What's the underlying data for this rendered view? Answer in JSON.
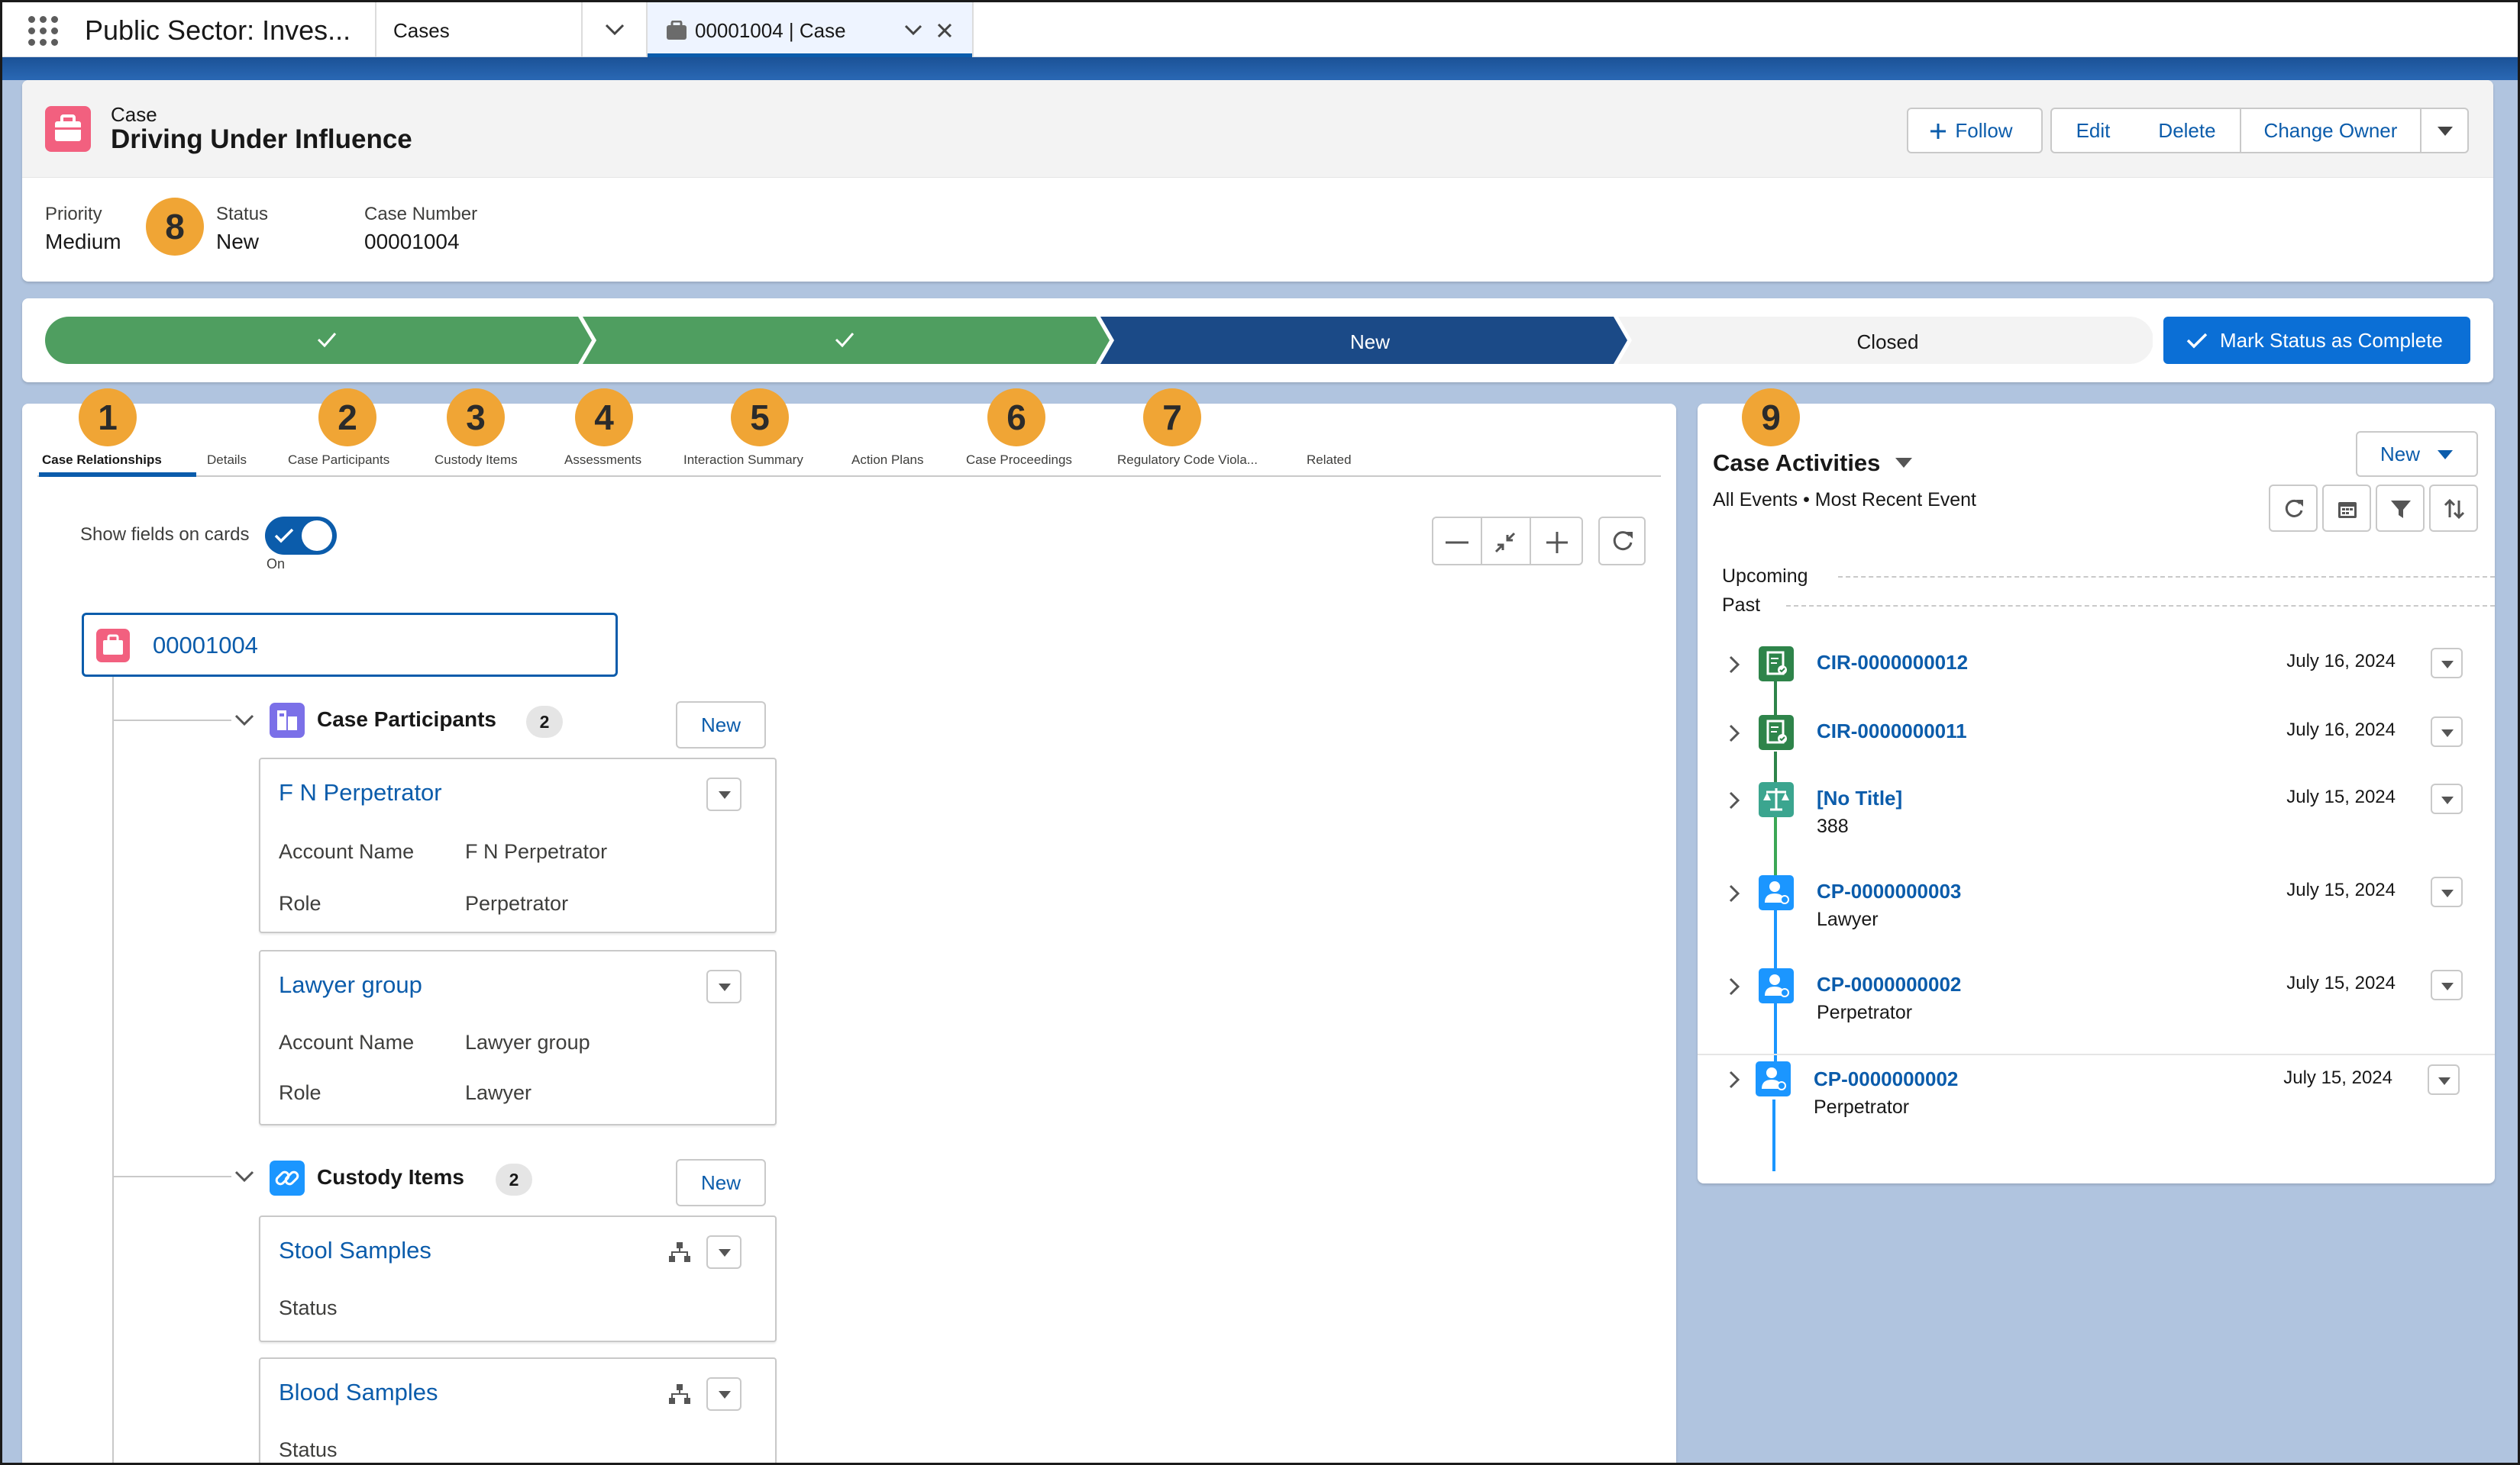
{
  "app": {
    "name": "Public Sector: Inves...",
    "tabs": [
      {
        "label": "Cases"
      },
      {
        "label": "00001004 | Case"
      }
    ]
  },
  "record": {
    "object_label": "Case",
    "title": "Driving Under Influence",
    "actions": {
      "follow": "Follow",
      "edit": "Edit",
      "delete": "Delete",
      "change_owner": "Change Owner"
    },
    "fields": [
      {
        "label": "Priority",
        "value": "Medium"
      },
      {
        "label": "Status",
        "value": "New"
      },
      {
        "label": "Case Number",
        "value": "00001004"
      }
    ]
  },
  "path": {
    "stages": [
      {
        "label": "",
        "state": "complete"
      },
      {
        "label": "",
        "state": "complete"
      },
      {
        "label": "New",
        "state": "current"
      },
      {
        "label": "Closed",
        "state": "incomplete"
      }
    ],
    "mark_button": "Mark Status as Complete"
  },
  "callouts": [
    "1",
    "2",
    "3",
    "4",
    "5",
    "6",
    "7",
    "8",
    "9"
  ],
  "main": {
    "tabs": [
      {
        "label": "Case Relationships"
      },
      {
        "label": "Details"
      },
      {
        "label": "Case Participants"
      },
      {
        "label": "Custody Items"
      },
      {
        "label": "Assessments"
      },
      {
        "label": "Interaction Summary"
      },
      {
        "label": "Action Plans"
      },
      {
        "label": "Case Proceedings"
      },
      {
        "label": "Regulatory Code Viola..."
      },
      {
        "label": "Related"
      }
    ],
    "toggle": {
      "label": "Show fields on cards",
      "state_text": "On"
    },
    "root_node": "00001004",
    "groups": [
      {
        "title": "Case Participants",
        "count": "2",
        "new_label": "New",
        "records": [
          {
            "title": "F N Perpetrator",
            "fields": [
              {
                "label": "Account Name",
                "value": "F N Perpetrator"
              },
              {
                "label": "Role",
                "value": "Perpetrator"
              }
            ]
          },
          {
            "title": "Lawyer group",
            "fields": [
              {
                "label": "Account Name",
                "value": "Lawyer group"
              },
              {
                "label": "Role",
                "value": "Lawyer"
              }
            ]
          }
        ]
      },
      {
        "title": "Custody Items",
        "count": "2",
        "new_label": "New",
        "records": [
          {
            "title": "Stool Samples",
            "fields": [
              {
                "label": "Status",
                "value": ""
              }
            ]
          },
          {
            "title": "Blood Samples",
            "fields": [
              {
                "label": "Status",
                "value": ""
              }
            ]
          }
        ]
      }
    ]
  },
  "activities": {
    "title": "Case Activities",
    "subtitle": "All Events • Most Recent Event",
    "new_label": "New",
    "upcoming_label": "Upcoming",
    "past_label": "Past",
    "items": [
      {
        "name": "CIR-0000000012",
        "sub": "",
        "date": "July 16, 2024",
        "icon": "document-check-icon"
      },
      {
        "name": "CIR-0000000011",
        "sub": "",
        "date": "July 16, 2024",
        "icon": "document-check-icon"
      },
      {
        "name": "[No Title]",
        "sub": "388",
        "date": "July 15, 2024",
        "icon": "scales-icon"
      },
      {
        "name": "CP-0000000003",
        "sub": "Lawyer",
        "date": "July 15, 2024",
        "icon": "person-icon"
      },
      {
        "name": "CP-0000000002",
        "sub": "Perpetrator",
        "date": "July 15, 2024",
        "icon": "person-icon"
      },
      {
        "name": "CP-0000000002",
        "sub": "Perpetrator",
        "date": "July 15, 2024",
        "icon": "person-icon"
      }
    ]
  },
  "colors": {
    "brand_blue": "#0b5cab",
    "path_complete": "#4f9e60",
    "path_current": "#1b4a87",
    "callout": "#f0a535",
    "case_icon": "#f2607f"
  }
}
